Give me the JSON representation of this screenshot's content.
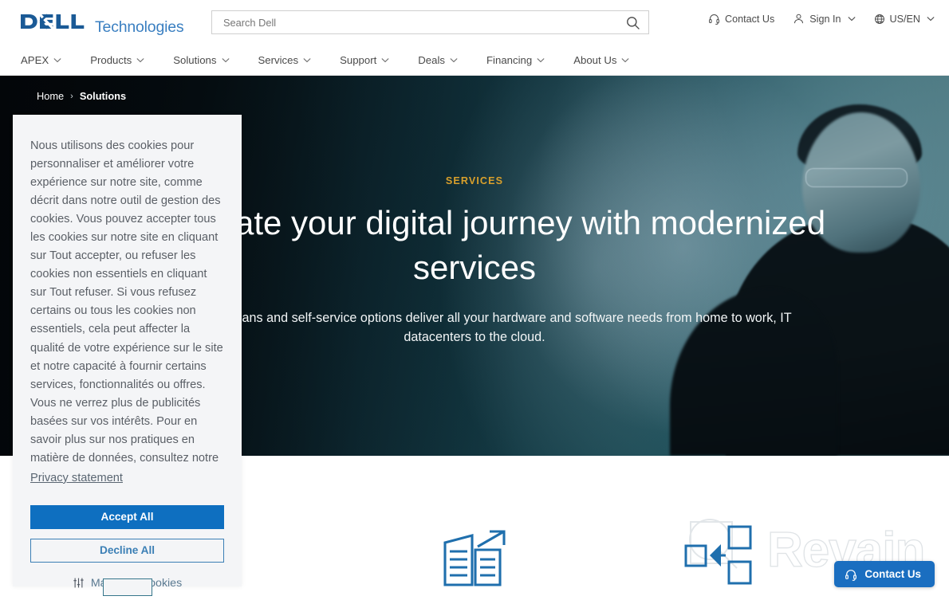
{
  "brand": {
    "logo_dell": "D<LL",
    "logo_suffix": "Technologies",
    "accent_blue": "#0e6fc0",
    "logo_blue": "#1a5a96",
    "logo_tech_blue": "#3a7fc1"
  },
  "search": {
    "placeholder": "Search Dell",
    "value": "",
    "icon": "search-icon"
  },
  "utility_nav": [
    {
      "label": "Contact Us",
      "icon": "headset-icon",
      "has_caret": false
    },
    {
      "label": "Sign In",
      "icon": "person-icon",
      "has_caret": true
    },
    {
      "label": "US/EN",
      "icon": "globe-icon",
      "has_caret": true
    }
  ],
  "main_nav": [
    {
      "label": "APEX"
    },
    {
      "label": "Products"
    },
    {
      "label": "Solutions"
    },
    {
      "label": "Services"
    },
    {
      "label": "Support"
    },
    {
      "label": "Deals"
    },
    {
      "label": "Financing"
    },
    {
      "label": "About Us"
    }
  ],
  "breadcrumb": {
    "home": "Home",
    "separator": "›",
    "current": "Solutions"
  },
  "hero": {
    "eyebrow": "SERVICES",
    "eyebrow_color": "#d9a02b",
    "title": "Accelerate your digital journey with modernized services",
    "subtitle": "Expert technicians and self-service options deliver all your hardware and software needs from home to work, IT datacenters to the cloud."
  },
  "cookie_banner": {
    "body": "Nous utilisons des cookies pour personnaliser et améliorer votre expérience sur notre site, comme décrit dans notre outil de gestion des cookies. Vous pouvez accepter tous les cookies sur notre site en cliquant sur Tout accepter, ou refuser les cookies non essentiels en cliquant sur Tout refuser. Si vous refusez certains ou tous les cookies non essentiels, cela peut affecter la qualité de votre expérience sur le site et notre capacité à fournir certains services, fonctionnalités ou offres. Vous ne verrez plus de publicités basées sur vos intérêts. Pour en savoir plus sur nos pratiques en matière de données, consultez notre",
    "privacy_link": "Privacy statement",
    "accept_label": "Accept All",
    "decline_label": "Decline All",
    "manage_label": "Managing cookies",
    "manage_icon": "sliders-icon"
  },
  "content": {
    "feature_icon": "buildings-growth-icon"
  },
  "floating_contact": {
    "label": "Contact Us",
    "icon": "headset-icon",
    "color": "#1a6ec0"
  },
  "watermark": {
    "text": "Revain",
    "logo_icon": "revain-q-icon",
    "consolidate_icon": "consolidate-arrow-icon"
  }
}
